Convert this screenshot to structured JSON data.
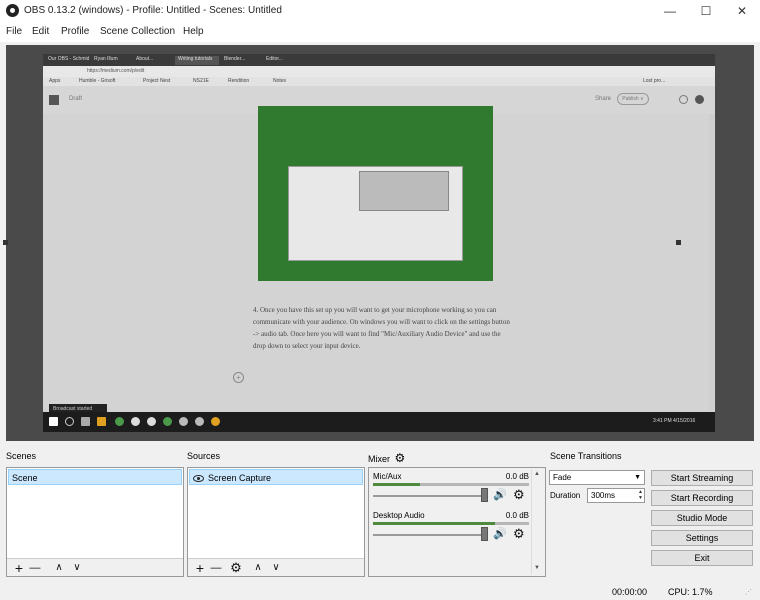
{
  "window": {
    "title": "OBS 0.13.2 (windows) - Profile: Untitled - Scenes: Untitled",
    "minimize": "—",
    "maximize": "☐",
    "close": "✕"
  },
  "menu": [
    "File",
    "Edit",
    "Profile",
    "Scene Collection",
    "Help"
  ],
  "preview": {
    "tabs": [
      "Our OBS - Schmid",
      "Ryan Illum",
      "About...",
      "Writing tutorials",
      "Blender...",
      "Editor..."
    ],
    "url": "https://medium.com/p/edit",
    "bookmarks": [
      "Apps",
      "Humble - Grisoft",
      "Project Nest",
      "NS21E",
      "Rendition",
      "Notes",
      "Lost pro..."
    ],
    "site_logo": "M",
    "site_crumb": "Draft",
    "share_label": "Share",
    "publish_label": "Publish ∨",
    "article_text": "4. Once you have this set up you will want to get your microphone working so you can communicate with your audience. On windows you will want to click on the settings button -> audio tab. Once here you will want to find \"Mic/Auxiliary Audio Device\" and use the drop down to select your input device.",
    "plus": "+",
    "notif_text": "Broadcast started",
    "clock": "3:41 PM 4/15/2016"
  },
  "scenes": {
    "label": "Scenes",
    "items": [
      "Scene"
    ]
  },
  "sources": {
    "label": "Sources",
    "items": [
      "Screen Capture"
    ]
  },
  "mixer": {
    "label": "Mixer",
    "channels": [
      {
        "name": "Mic/Aux",
        "db": "0.0 dB",
        "level": 0.3,
        "volume": 0.98
      },
      {
        "name": "Desktop Audio",
        "db": "0.0 dB",
        "level": 0.78,
        "volume": 0.98
      }
    ]
  },
  "transitions": {
    "label": "Scene Transitions",
    "selected": "Fade",
    "duration_label": "Duration",
    "duration_value": "300ms"
  },
  "controls": [
    "Start Streaming",
    "Start Recording",
    "Studio Mode",
    "Settings",
    "Exit"
  ],
  "icons": {
    "add": "+",
    "remove": "—",
    "up": "∧",
    "down": "∨",
    "gear": "⚙",
    "speaker": "🔊",
    "caret": "▼"
  },
  "status": {
    "time": "00:00:00",
    "cpu": "CPU: 1.7%"
  }
}
